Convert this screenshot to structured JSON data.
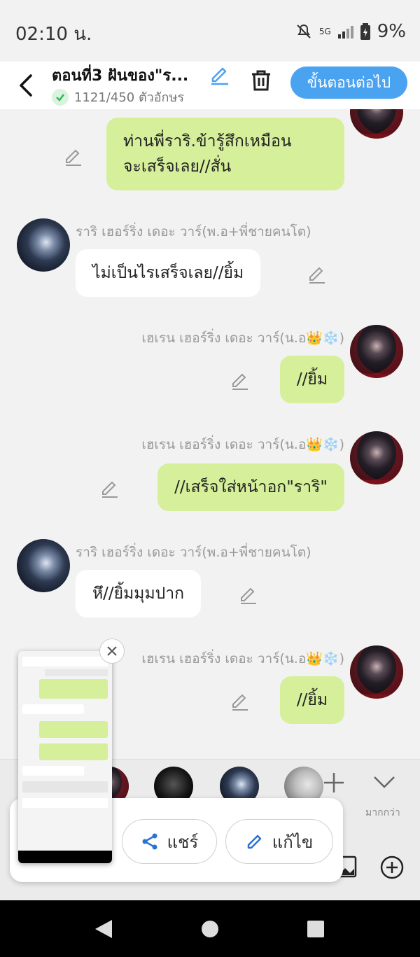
{
  "status_bar": {
    "time": "02:10 น.",
    "battery": "9%",
    "network": "5G"
  },
  "header": {
    "title": "ตอนที่3 ฝันของ\"ร...",
    "char_count": "1121/450 ตัวอักษร",
    "next_button": "ขั้นตอนต่อไป"
  },
  "messages": [
    {
      "text_line1": "ท่านพี่ราริ.ข้ารู้สึกเหมือน",
      "text_line2": "จะเสร็จเลย//สั่น"
    },
    {
      "name": "ราริ เฮอร์ริ่ง เดอะ วาร์(พ.อ+พี่ชายคนโต)",
      "text": "ไม่เป็นไรเสร็จเลย//ยิ้ม"
    },
    {
      "name": "เฮเรน เฮอร์ริ่ง เดอะ วาร์(น.อ👑❄️)",
      "text": "//ยิ้ม"
    },
    {
      "name": "เฮเรน เฮอร์ริ่ง เดอะ วาร์(น.อ👑❄️)",
      "text": "//เสร็จใส่หน้าอก\"ราริ\""
    },
    {
      "name": "ราริ เฮอร์ริ่ง เดอะ วาร์(พ.อ+พี่ชายคนโต)",
      "text": "หึ//ยิ้มมุมปาก"
    },
    {
      "name": "เฮเรน เฮอร์ริ่ง เดอะ วาร์(น.อ👑❄️)",
      "text": "//ยิ้ม"
    }
  ],
  "bottom": {
    "more_label": "มากกว่า"
  },
  "share_popup": {
    "share_label": "แชร์",
    "edit_label": "แก้ไข"
  },
  "colors": {
    "accent": "#4aa3f0",
    "bubble_green": "#d5ef9a",
    "bubble_white": "#ffffff"
  }
}
